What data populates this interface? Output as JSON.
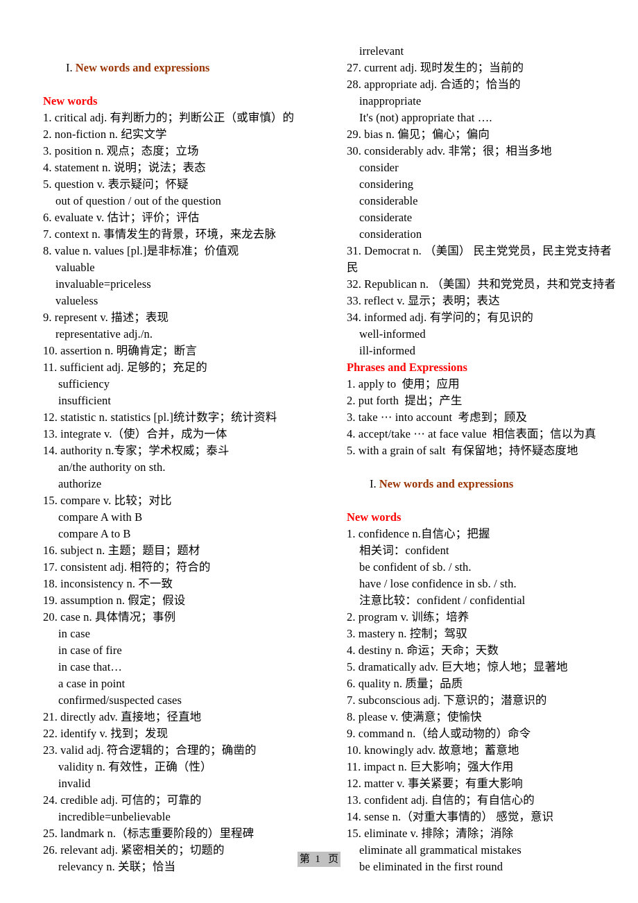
{
  "colors": {
    "section_heading": "#993300",
    "sub_heading": "#ff0000",
    "body_text": "#000000",
    "footer_highlight": "#c0c0c0"
  },
  "left_column": {
    "heading_numeral": "I. ",
    "heading_title": "New words and expressions",
    "sub_heading": "New words",
    "entries": [
      {
        "text": "1. critical adj. 有判断力的；判断公正（或审慎）的",
        "indent": 0
      },
      {
        "text": "2. non-fiction n. 纪实文学",
        "indent": 0
      },
      {
        "text": "3. position n. 观点；态度；立场",
        "indent": 0
      },
      {
        "text": "4. statement n. 说明；说法；表态",
        "indent": 0
      },
      {
        "text": "5. question v. 表示疑问；怀疑",
        "indent": 0
      },
      {
        "text": "out of question / out of the question",
        "indent": 1
      },
      {
        "text": "6. evaluate v. 估计；评价；评估",
        "indent": 0
      },
      {
        "text": "7. context n. 事情发生的背景，环境，来龙去脉",
        "indent": 0
      },
      {
        "text": "8. value n. values [pl.]是非标准；价值观",
        "indent": 0
      },
      {
        "text": "valuable",
        "indent": 1
      },
      {
        "text": "invaluable=priceless",
        "indent": 1
      },
      {
        "text": "valueless",
        "indent": 1
      },
      {
        "text": "9. represent v. 描述；表现",
        "indent": 0
      },
      {
        "text": "representative adj./n.",
        "indent": 1
      },
      {
        "text": "10. assertion n. 明确肯定；断言",
        "indent": 0
      },
      {
        "text": "11. sufficient adj. 足够的；充足的",
        "indent": 0
      },
      {
        "text": "sufficiency",
        "indent": 2
      },
      {
        "text": "insufficient",
        "indent": 2
      },
      {
        "text": "12. statistic n. statistics [pl.]统计数字；统计资料",
        "indent": 0
      },
      {
        "text": "13. integrate v.（使）合并，成为一体",
        "indent": 0
      },
      {
        "text": "14. authority n.专家；学术权威；泰斗",
        "indent": 0
      },
      {
        "text": "an/the authority on sth.",
        "indent": 2
      },
      {
        "text": "authorize",
        "indent": 2
      },
      {
        "text": "15. compare v. 比较；对比",
        "indent": 0
      },
      {
        "text": "compare A with B",
        "indent": 2
      },
      {
        "text": "compare A to B",
        "indent": 2
      },
      {
        "text": "16. subject n. 主题；题目；题材",
        "indent": 0
      },
      {
        "text": "17. consistent adj. 相符的；符合的",
        "indent": 0
      },
      {
        "text": "18. inconsistency n. 不一致",
        "indent": 0
      },
      {
        "text": "19. assumption n. 假定；假设",
        "indent": 0
      },
      {
        "text": "20. case n. 具体情况；事例",
        "indent": 0
      },
      {
        "text": "in case",
        "indent": 2
      },
      {
        "text": "in case of fire",
        "indent": 2
      },
      {
        "text": "in case that…",
        "indent": 2
      },
      {
        "text": "a case in point",
        "indent": 2
      },
      {
        "text": "confirmed/suspected cases",
        "indent": 2
      },
      {
        "text": "21. directly adv. 直接地；径直地",
        "indent": 0
      },
      {
        "text": "22. identify v. 找到；发现",
        "indent": 0
      },
      {
        "text": "23. valid adj. 符合逻辑的；合理的；确凿的",
        "indent": 0
      },
      {
        "text": "validity n. 有效性，正确（性）",
        "indent": 2
      },
      {
        "text": "invalid",
        "indent": 2
      },
      {
        "text": "24. credible adj. 可信的；可靠的",
        "indent": 0
      },
      {
        "text": "incredible=unbelievable",
        "indent": 2
      },
      {
        "text": "25. landmark n.（标志重要阶段的）里程碑",
        "indent": 0
      },
      {
        "text": "26. relevant adj. 紧密相关的；切题的",
        "indent": 0
      },
      {
        "text": "relevancy n. 关联；恰当",
        "indent": 2
      }
    ]
  },
  "right_column": {
    "entries_top": [
      {
        "text": "irrelevant",
        "indent": 1
      },
      {
        "text": "27. current adj. 现时发生的；当前的",
        "indent": 0
      },
      {
        "text": "28. appropriate adj. 合适的；恰当的",
        "indent": 0
      },
      {
        "text": "inappropriate",
        "indent": 1
      },
      {
        "text": "It's (not) appropriate that ….",
        "indent": 1
      },
      {
        "text": "29. bias n. 偏见；偏心；偏向",
        "indent": 0
      },
      {
        "text": "30. considerably adv. 非常；很；相当多地",
        "indent": 0
      },
      {
        "text": "consider",
        "indent": 1
      },
      {
        "text": "considering",
        "indent": 1
      },
      {
        "text": "considerable",
        "indent": 1
      },
      {
        "text": "considerate",
        "indent": 1
      },
      {
        "text": "consideration",
        "indent": 1
      },
      {
        "text": "31. Democrat n. （美国） 民主党党员，民主党支持者",
        "indent": 0
      },
      {
        "text": "民",
        "indent": 0
      },
      {
        "text": "32. Republican n. （美国）共和党党员，共和党支持者",
        "indent": 0
      },
      {
        "text": "33. reflect v. 显示；表明；表达",
        "indent": 0
      },
      {
        "text": "34. informed adj. 有学问的；有见识的",
        "indent": 0
      },
      {
        "text": "well-informed",
        "indent": 1
      },
      {
        "text": "ill-informed",
        "indent": 1
      }
    ],
    "phrases_heading": "Phrases and Expressions",
    "phrases": [
      {
        "text": "1. apply to  使用；应用",
        "indent": 0
      },
      {
        "text": "2. put forth  提出；产生",
        "indent": 0
      },
      {
        "text": "3. take ⋯ into account  考虑到；顾及",
        "indent": 0
      },
      {
        "text": "4. accept/take ⋯ at face value  相信表面；信以为真",
        "indent": 0
      },
      {
        "text": "5. with a grain of salt  有保留地；持怀疑态度地",
        "indent": 0
      }
    ],
    "heading2_numeral": "I. ",
    "heading2_title": "New words and expressions",
    "sub_heading2": "New words",
    "entries_bottom": [
      {
        "text": "1. confidence n.自信心；把握",
        "indent": 0
      },
      {
        "text": "相关词：confident",
        "indent": 1
      },
      {
        "text": "be confident of sb. / sth.",
        "indent": 1
      },
      {
        "text": "have / lose confidence in sb. / sth.",
        "indent": 1
      },
      {
        "text": "注意比较：confident / confidential",
        "indent": 1
      },
      {
        "text": "2. program v. 训练；培养",
        "indent": 0
      },
      {
        "text": "3. mastery n. 控制；驾驭",
        "indent": 0
      },
      {
        "text": "4. destiny n. 命运；天命；天数",
        "indent": 0
      },
      {
        "text": "5. dramatically adv. 巨大地；惊人地；显著地",
        "indent": 0
      },
      {
        "text": "6. quality n. 质量；品质",
        "indent": 0
      },
      {
        "text": "7. subconscious adj. 下意识的；潜意识的",
        "indent": 0
      },
      {
        "text": "8. please v. 使满意；使愉快",
        "indent": 0
      },
      {
        "text": "9. command n.（给人或动物的）命令",
        "indent": 0
      },
      {
        "text": "10. knowingly adv. 故意地；蓄意地",
        "indent": 0
      },
      {
        "text": "11. impact n. 巨大影响；强大作用",
        "indent": 0
      },
      {
        "text": "12. matter v. 事关紧要；有重大影响",
        "indent": 0
      },
      {
        "text": "13. confident adj. 自信的；有自信心的",
        "indent": 0
      },
      {
        "text": "14. sense n.（对重大事情的） 感觉，意识",
        "indent": 0
      },
      {
        "text": "15. eliminate v. 排除；清除；消除",
        "indent": 0
      },
      {
        "text": "eliminate all grammatical mistakes",
        "indent": 1
      },
      {
        "text": "be eliminated in the first round",
        "indent": 1
      }
    ]
  },
  "footer": {
    "page_label": "第  1   页"
  }
}
